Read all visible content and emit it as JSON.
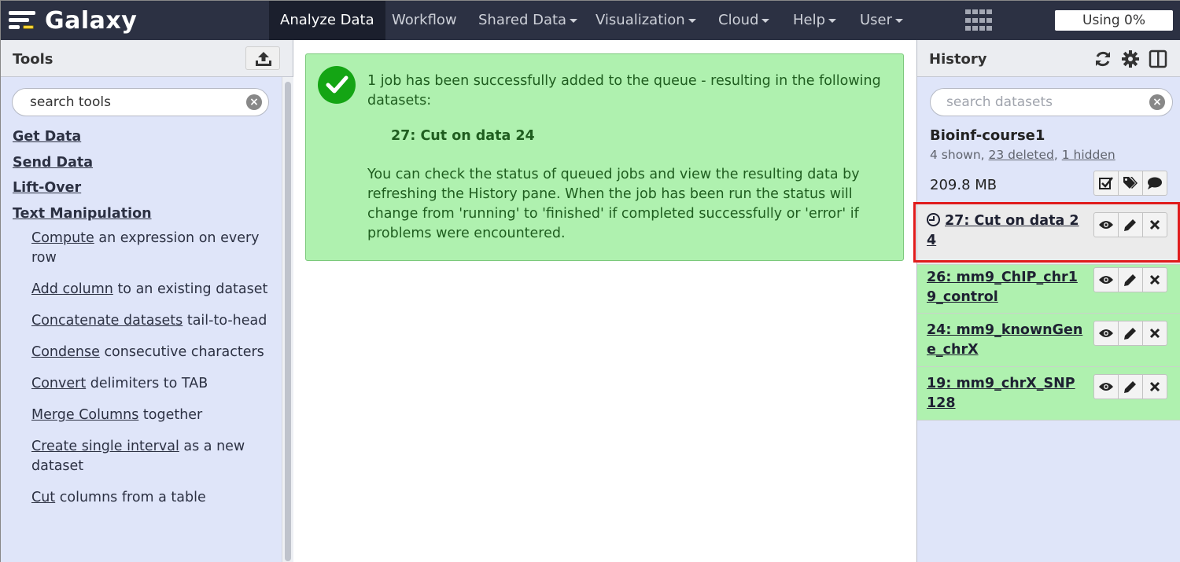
{
  "brand": {
    "title": "Galaxy"
  },
  "nav": {
    "items": [
      {
        "label": "Analyze Data",
        "active": true,
        "dropdown": false
      },
      {
        "label": "Workflow",
        "active": false,
        "dropdown": false
      },
      {
        "label": "Shared Data",
        "active": false,
        "dropdown": true
      },
      {
        "label": "Visualization",
        "active": false,
        "dropdown": true
      },
      {
        "label": "Cloud",
        "active": false,
        "dropdown": true
      },
      {
        "label": "Help",
        "active": false,
        "dropdown": true
      },
      {
        "label": "User",
        "active": false,
        "dropdown": true
      }
    ],
    "quota_label": "Using 0%"
  },
  "tools": {
    "title": "Tools",
    "search_value": "search tools",
    "sections": [
      {
        "label": "Get Data"
      },
      {
        "label": "Send Data"
      },
      {
        "label": "Lift-Over"
      },
      {
        "label": "Text Manipulation"
      }
    ],
    "entries": [
      {
        "link": "Compute",
        "rest": " an expression on every row"
      },
      {
        "link": "Add column",
        "rest": " to an existing dataset"
      },
      {
        "link": "Concatenate datasets",
        "rest": " tail-to-head"
      },
      {
        "link": "Condense",
        "rest": " consecutive characters"
      },
      {
        "link": "Convert",
        "rest": " delimiters to TAB"
      },
      {
        "link": "Merge Columns",
        "rest": " together"
      },
      {
        "link": "Create single interval",
        "rest": " as a new dataset"
      },
      {
        "link": "Cut",
        "rest": " columns from a table"
      }
    ]
  },
  "message": {
    "intro": "1 job has been successfully added to the queue - resulting in the following datasets:",
    "dataset": "27: Cut on data 24",
    "detail": "You can check the status of queued jobs and view the resulting data by refreshing the History pane. When the job has been run the status will change from 'running' to 'finished' if completed successfully or 'error' if problems were encountered."
  },
  "history": {
    "title": "History",
    "search_placeholder": "search datasets",
    "name": "Bioinf-course1",
    "counts": {
      "shown": "4 shown, ",
      "deleted": "23 deleted",
      "sep": ", ",
      "hidden": "1 hidden"
    },
    "size": "209.8 MB",
    "datasets": [
      {
        "title": "27: Cut on data 24",
        "state": "queued"
      },
      {
        "title": "26: mm9_ChIP_chr19_control",
        "state": "ok"
      },
      {
        "title": "24: mm9_knownGene_chrX",
        "state": "ok"
      },
      {
        "title": "19: mm9_chrX_SNP128",
        "state": "ok"
      }
    ]
  },
  "colors": {
    "navbar": "#2c3143",
    "panel": "#dfe5f9",
    "success": "#aff1af",
    "queued": "#ebebeb",
    "highlight": "#e01c1c"
  }
}
